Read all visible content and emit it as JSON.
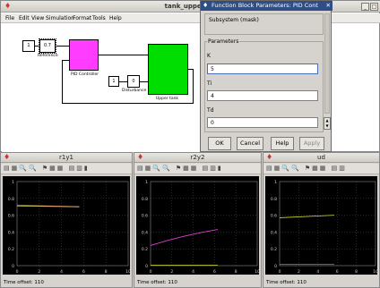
{
  "main_window": {
    "title": "tank_upper *[n",
    "menu": [
      "File",
      "Edit",
      "View",
      "Simulation",
      "Format",
      "Tools",
      "Help"
    ],
    "blocks": {
      "const1": "1",
      "gain": "0.7",
      "reference_label": "Reference",
      "pid_label": "PID Controller",
      "const2": "1",
      "const3": "0",
      "disturbance_label": "Disturbance",
      "tank_label": "Upper tank"
    }
  },
  "dialog": {
    "title": "Function Block Parameters: PID Cont",
    "subsystem": "Subsystem (mask)",
    "section": "Parameters",
    "params": [
      {
        "label": "K",
        "value": "5"
      },
      {
        "label": "Ti",
        "value": "4"
      },
      {
        "label": "Td",
        "value": "0"
      }
    ],
    "buttons": {
      "ok": "OK",
      "cancel": "Cancel",
      "help": "Help",
      "apply": "Apply"
    }
  },
  "scopes": [
    {
      "title": "r1y1",
      "offset": "Time offset:  110",
      "yticks": [
        "1",
        "0.8",
        "0.6",
        "0.4",
        "0.2",
        "0"
      ],
      "xticks": [
        "0",
        "2",
        "4",
        "6",
        "8",
        "10"
      ]
    },
    {
      "title": "r2y2",
      "offset": "Time offset:  110",
      "yticks": [
        "1",
        "0.8",
        "0.6",
        "0.4",
        "0.2",
        "0"
      ],
      "xticks": [
        "0",
        "2",
        "4",
        "6",
        "8",
        "10"
      ]
    },
    {
      "title": "ud",
      "offset": "Time offset:  110",
      "yticks": [
        "1",
        "0.8",
        "0.6",
        "0.4",
        "0.2",
        "0"
      ],
      "xticks": [
        "0",
        "2",
        "4",
        "6",
        "8",
        "10"
      ]
    }
  ],
  "colors": {
    "pid": "#ff3cff",
    "tank": "#00dd00",
    "trace_yellow": "#d8d838",
    "trace_magenta": "#e040e0",
    "dialog_title": "#304e86"
  }
}
